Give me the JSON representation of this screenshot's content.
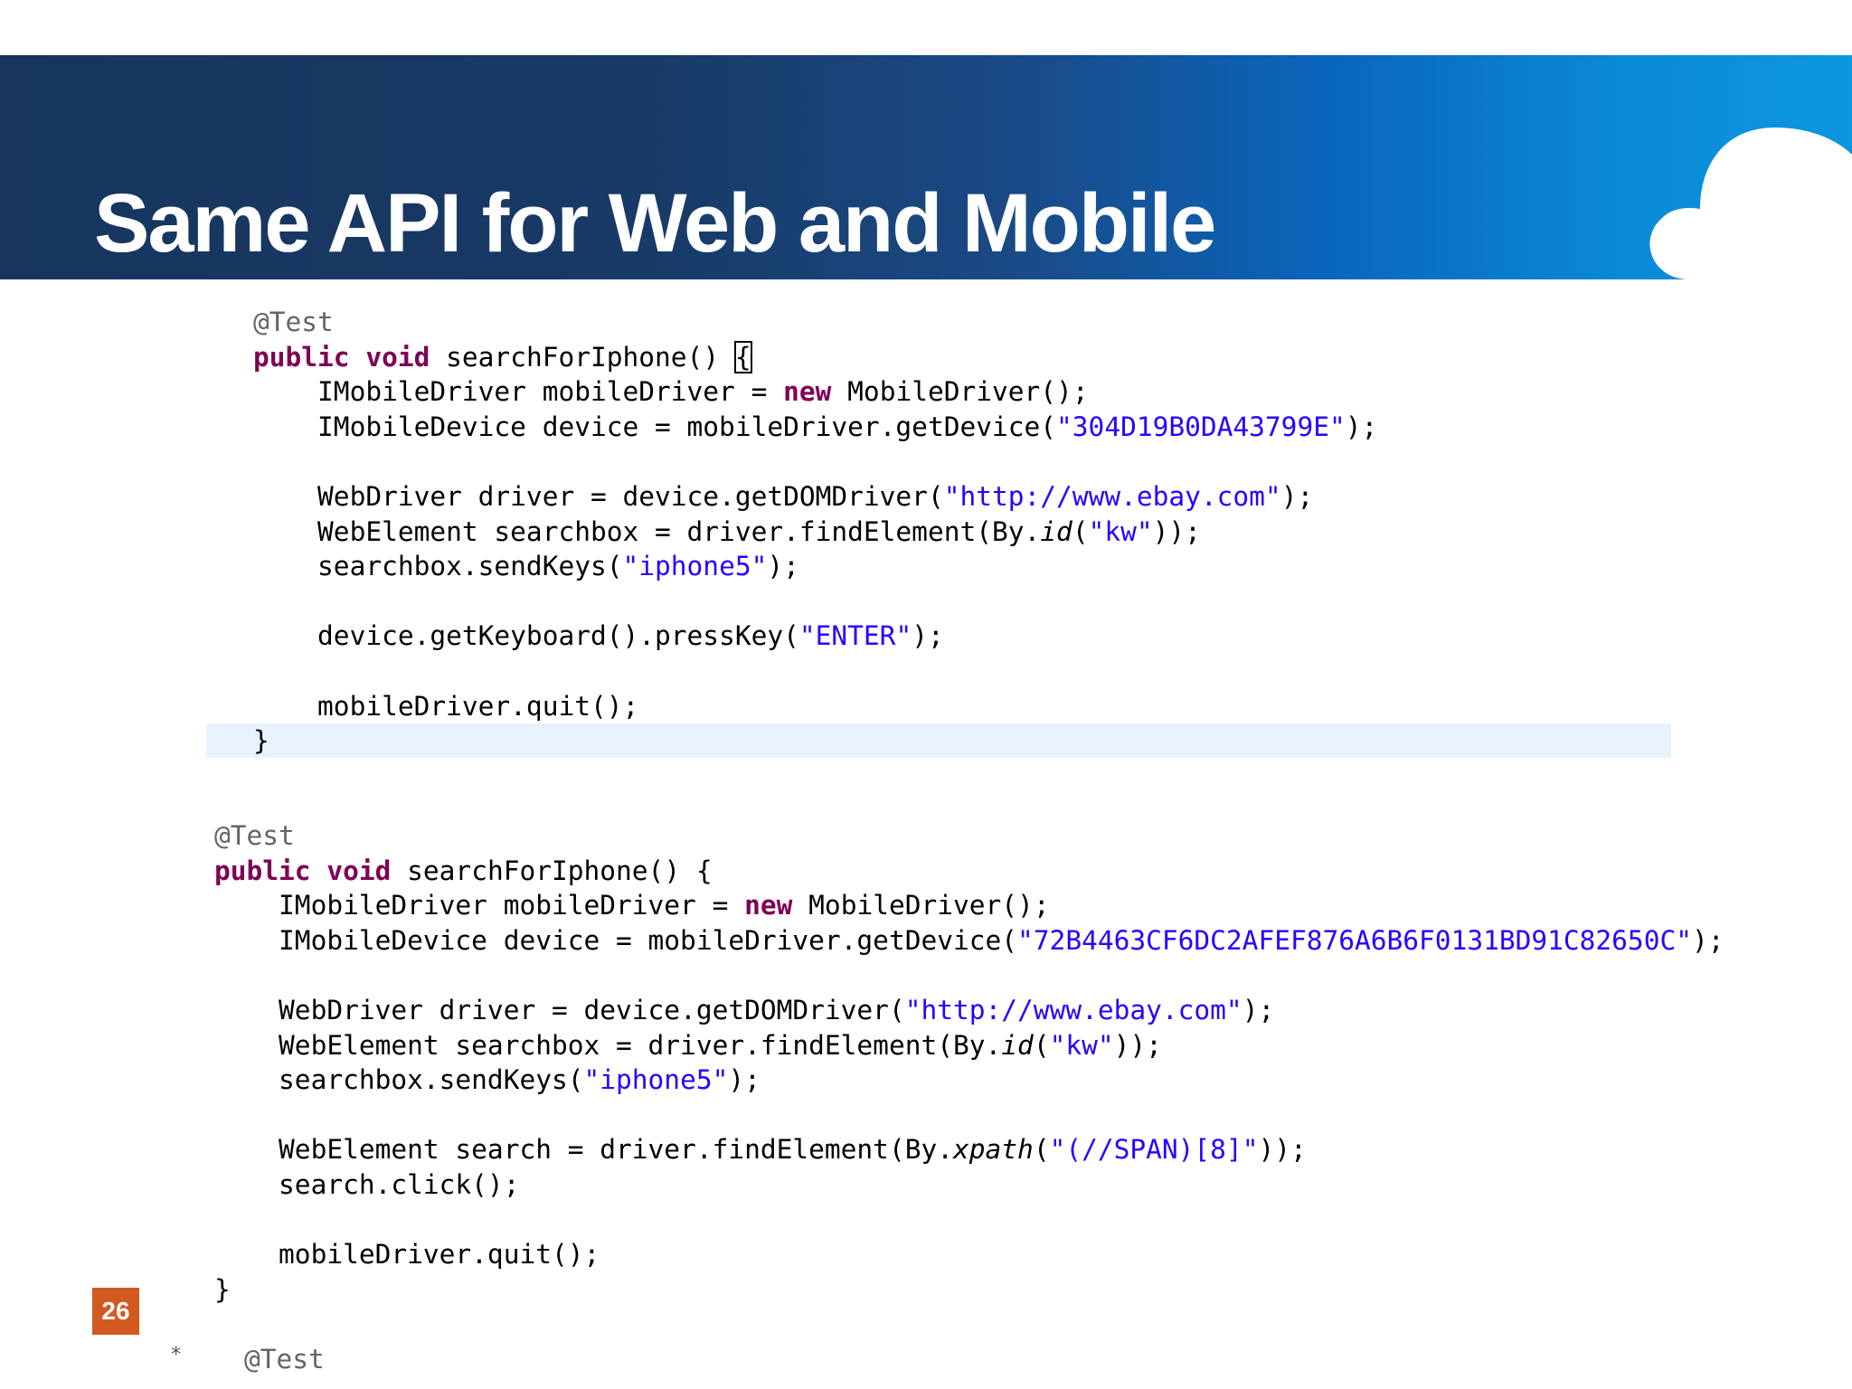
{
  "slide": {
    "title": "Same API for Web and Mobile",
    "page_number": "26"
  },
  "block1": {
    "annotation": "@Test",
    "kw_public": "public",
    "kw_void": "void",
    "sig_rest": " searchForIphone() ",
    "brace_open": "{",
    "l3_a": "IMobileDriver mobileDriver = ",
    "l3_kw": "new",
    "l3_b": " MobileDriver();",
    "l4_a": "IMobileDevice device = mobileDriver.getDevice(",
    "l4_str": "\"304D19B0DA43799E\"",
    "l4_b": ");",
    "l6_a": "WebDriver driver = device.getDOMDriver(",
    "l6_str": "\"http://www.ebay.com\"",
    "l6_b": ");",
    "l7_a": "WebElement searchbox = driver.findElement(By.",
    "l7_it": "id",
    "l7_b": "(",
    "l7_str": "\"kw\"",
    "l7_c": "));",
    "l8_a": "searchbox.sendKeys(",
    "l8_str": "\"iphone5\"",
    "l8_b": ");",
    "l10_a": "device.getKeyboard().pressKey(",
    "l10_str": "\"ENTER\"",
    "l10_b": ");",
    "l12": "mobileDriver.quit();",
    "brace_close": "}"
  },
  "block2": {
    "annotation": "@Test",
    "kw_public": "public",
    "kw_void": "void",
    "sig_rest": " searchForIphone() {",
    "l3_a": "IMobileDriver mobileDriver = ",
    "l3_kw": "new",
    "l3_b": " MobileDriver();",
    "l4_a": "IMobileDevice device = mobileDriver.getDevice(",
    "l4_str": "\"72B4463CF6DC2AFEF876A6B6F0131BD91C82650C\"",
    "l4_b": ");",
    "l6_a": "WebDriver driver = device.getDOMDriver(",
    "l6_str": "\"http://www.ebay.com\"",
    "l6_b": ");",
    "l7_a": "WebElement searchbox = driver.findElement(By.",
    "l7_it": "id",
    "l7_b": "(",
    "l7_str": "\"kw\"",
    "l7_c": "));",
    "l8_a": "searchbox.sendKeys(",
    "l8_str": "\"iphone5\"",
    "l8_b": ");",
    "l10_a": "WebElement search = driver.findElement(By.",
    "l10_it": "xpath",
    "l10_b": "(",
    "l10_str": "\"(//SPAN)[8]\"",
    "l10_c": "));",
    "l11": "search.click();",
    "l13": "mobileDriver.quit();",
    "brace_close": "}"
  },
  "block3": {
    "star": "*",
    "annotation": "@Test"
  },
  "colors": {
    "keyword": "#7f0055",
    "string": "#2a00ff",
    "annotation": "#646464",
    "page_badge": "#d35a1e",
    "banner_dark": "#17355e",
    "banner_light": "#0d97e0"
  }
}
